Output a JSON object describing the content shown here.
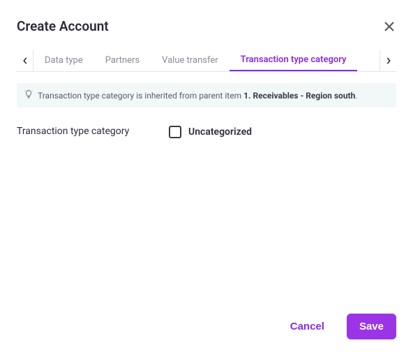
{
  "header": {
    "title": "Create Account"
  },
  "tabs": {
    "items": [
      {
        "label": "Data type"
      },
      {
        "label": "Partners"
      },
      {
        "label": "Value transfer"
      },
      {
        "label": "Transaction type category"
      }
    ],
    "activeIndex": 3
  },
  "hint": {
    "prefix": "Transaction type category is inherited from parent item ",
    "bold": "1. Receivables - Region south",
    "suffix": "."
  },
  "form": {
    "label": "Transaction type category",
    "checkbox_label": "Uncategorized",
    "checkbox_checked": false
  },
  "footer": {
    "cancel": "Cancel",
    "save": "Save"
  }
}
